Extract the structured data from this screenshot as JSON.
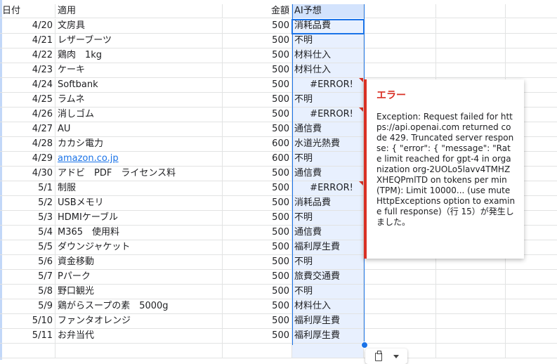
{
  "headers": {
    "date": "日付",
    "desc": "適用",
    "amount": "金額",
    "ai": "AI予想"
  },
  "rows": [
    {
      "date": "4/20",
      "desc": "文房具",
      "amount": "500",
      "ai": "消耗品費"
    },
    {
      "date": "4/21",
      "desc": "レザーブーツ",
      "amount": "500",
      "ai": "不明"
    },
    {
      "date": "4/22",
      "desc": "鶏肉　1kg",
      "amount": "500",
      "ai": "材料仕入"
    },
    {
      "date": "4/23",
      "desc": "ケーキ",
      "amount": "500",
      "ai": "材料仕入"
    },
    {
      "date": "4/24",
      "desc": "Softbank",
      "amount": "500",
      "ai": "#ERROR!",
      "error": true
    },
    {
      "date": "4/25",
      "desc": "ラムネ",
      "amount": "500",
      "ai": "不明"
    },
    {
      "date": "4/26",
      "desc": "消しゴム",
      "amount": "500",
      "ai": "#ERROR!",
      "error": true
    },
    {
      "date": "4/27",
      "desc": "AU",
      "amount": "500",
      "ai": "通信費"
    },
    {
      "date": "4/28",
      "desc": "カカシ電力",
      "amount": "600",
      "ai": "水道光熱費"
    },
    {
      "date": "4/29",
      "desc": "amazon.co.jp",
      "amount": "600",
      "ai": "不明",
      "link": true
    },
    {
      "date": "4/30",
      "desc": "アドビ　PDF　ライセンス料",
      "amount": "500",
      "ai": "通信費"
    },
    {
      "date": "5/1",
      "desc": "制服",
      "amount": "500",
      "ai": "#ERROR!",
      "error": true
    },
    {
      "date": "5/2",
      "desc": "USBメモリ",
      "amount": "500",
      "ai": "消耗品費"
    },
    {
      "date": "5/3",
      "desc": "HDMIケーブル",
      "amount": "500",
      "ai": "不明"
    },
    {
      "date": "5/4",
      "desc": "M365　使用料",
      "amount": "500",
      "ai": "通信費"
    },
    {
      "date": "5/5",
      "desc": "ダウンジャケット",
      "amount": "500",
      "ai": "福利厚生費"
    },
    {
      "date": "5/6",
      "desc": "資金移動",
      "amount": "500",
      "ai": "不明"
    },
    {
      "date": "5/7",
      "desc": "Pパーク",
      "amount": "500",
      "ai": "旅費交通費"
    },
    {
      "date": "5/8",
      "desc": "野口観光",
      "amount": "500",
      "ai": "不明"
    },
    {
      "date": "5/9",
      "desc": "鶏がらスープの素　5000g",
      "amount": "500",
      "ai": "材料仕入"
    },
    {
      "date": "5/10",
      "desc": "ファンタオレンジ",
      "amount": "500",
      "ai": "福利厚生費"
    },
    {
      "date": "5/11",
      "desc": "お弁当代",
      "amount": "500",
      "ai": "福利厚生費"
    }
  ],
  "error_popup": {
    "title": "エラー",
    "message": "Exception: Request failed for https://api.openai.com returned code 429. Truncated server response: { \"error\": { \"message\": \"Rate limit reached for gpt-4 in organization org-2UOLo5lavv4TMHZXHEQPmlTD on tokens per min (TPM): Limit 10000... (use muteHttpExceptions option to examine full response)（行 15）が発生しました。"
  },
  "colors": {
    "error": "#d93025",
    "selection": "#1a73e8",
    "selection_fill": "#e8f0fe",
    "link": "#1a73e8"
  },
  "icons": {
    "paste": "clipboard-icon",
    "dropdown": "chevron-down-icon"
  }
}
